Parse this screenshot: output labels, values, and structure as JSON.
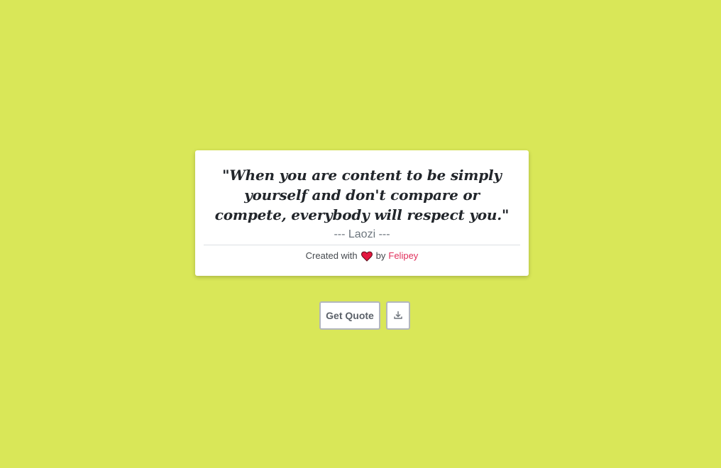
{
  "card": {
    "quote": "\"When you are content to be simply yourself and don't compare or compete, everybody will respect you.\"",
    "author": "--- Laozi ---",
    "credit_prefix": "Created with",
    "credit_icon": "heart-icon",
    "credit_by": "by",
    "credit_author": "Felipey"
  },
  "actions": {
    "get_quote_label": "Get Quote",
    "download_icon": "download-icon"
  },
  "colors": {
    "background": "#d9e758",
    "heart": "#e3173f",
    "link": "#e0305c"
  }
}
